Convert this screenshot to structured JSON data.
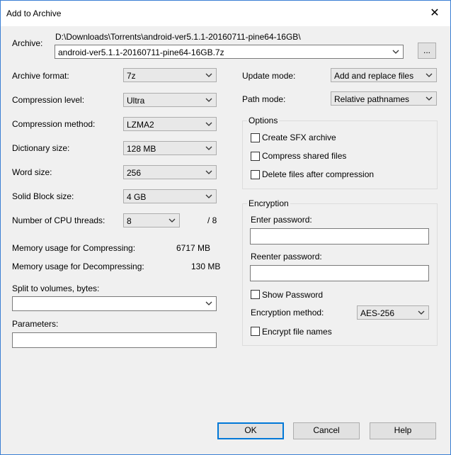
{
  "window": {
    "title": "Add to Archive",
    "close_glyph": "✕"
  },
  "archive": {
    "label": "Archive:",
    "path": "D:\\Downloads\\Torrents\\android-ver5.1.1-20160711-pine64-16GB\\",
    "filename": "android-ver5.1.1-20160711-pine64-16GB.7z",
    "browse_label": "..."
  },
  "left": {
    "format": {
      "label": "Archive format:",
      "value": "7z"
    },
    "level": {
      "label": "Compression level:",
      "value": "Ultra"
    },
    "method": {
      "label": "Compression method:",
      "value": "LZMA2"
    },
    "dict": {
      "label": "Dictionary size:",
      "value": "128 MB"
    },
    "word": {
      "label": "Word size:",
      "value": "256"
    },
    "solid": {
      "label": "Solid Block size:",
      "value": "4 GB"
    },
    "threads": {
      "label": "Number of CPU threads:",
      "value": "8",
      "max": "/ 8"
    },
    "mem_comp": {
      "label": "Memory usage for Compressing:",
      "value": "6717 MB"
    },
    "mem_decomp": {
      "label": "Memory usage for Decompressing:",
      "value": "130 MB"
    },
    "split": {
      "label": "Split to volumes, bytes:",
      "value": ""
    },
    "params": {
      "label": "Parameters:",
      "value": ""
    }
  },
  "right": {
    "update": {
      "label": "Update mode:",
      "value": "Add and replace files"
    },
    "path": {
      "label": "Path mode:",
      "value": "Relative pathnames"
    },
    "options": {
      "title": "Options",
      "sfx": "Create SFX archive",
      "shared": "Compress shared files",
      "delete": "Delete files after compression"
    },
    "encryption": {
      "title": "Encryption",
      "enter_label": "Enter password:",
      "reenter_label": "Reenter password:",
      "show_label": "Show Password",
      "method_label": "Encryption method:",
      "method_value": "AES-256",
      "names_label": "Encrypt file names"
    }
  },
  "buttons": {
    "ok": "OK",
    "cancel": "Cancel",
    "help": "Help"
  }
}
